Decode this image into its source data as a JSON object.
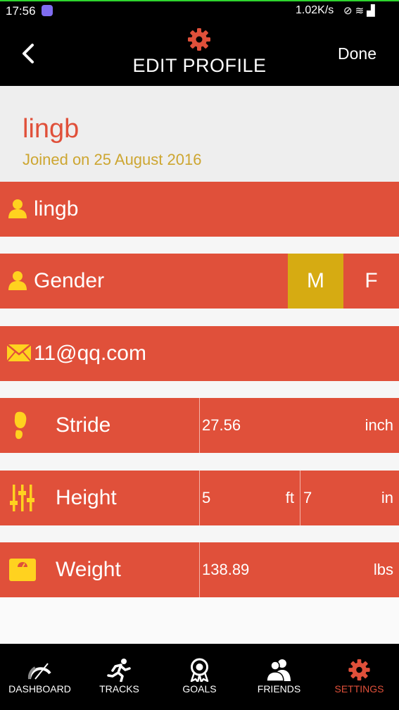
{
  "status_bar": {
    "time": "17:56",
    "network_speed": "1.02K/s"
  },
  "header": {
    "title": "EDIT PROFILE",
    "done_label": "Done"
  },
  "profile": {
    "name": "lingb",
    "joined": "Joined on 25 August 2016"
  },
  "fields": {
    "username": {
      "value": "lingb",
      "icon": "person-icon"
    },
    "gender": {
      "label": "Gender",
      "options": [
        "M",
        "F"
      ],
      "selected": "M",
      "icon": "person-icon"
    },
    "email": {
      "value": "11@qq.com",
      "icon": "envelope-icon"
    },
    "stride": {
      "label": "Stride",
      "value": "27.56",
      "unit": "inch",
      "icon": "footprint-icon"
    },
    "height": {
      "label": "Height",
      "feet": "5",
      "feet_unit": "ft",
      "inches": "7",
      "inches_unit": "in",
      "icon": "sliders-icon"
    },
    "weight": {
      "label": "Weight",
      "value": "138.89",
      "unit": "lbs",
      "icon": "scale-icon"
    }
  },
  "tabs": [
    {
      "label": "DASHBOARD",
      "icon": "speedometer-icon",
      "active": false
    },
    {
      "label": "TRACKS",
      "icon": "runner-icon",
      "active": false
    },
    {
      "label": "GOALS",
      "icon": "award-icon",
      "active": false
    },
    {
      "label": "FRIENDS",
      "icon": "friends-icon",
      "active": false
    },
    {
      "label": "SETTINGS",
      "icon": "gear-icon",
      "active": true
    }
  ],
  "colors": {
    "accent": "#e0503a",
    "selected_toggle": "#d6ab12",
    "icon_yellow": "#ffd21f",
    "joined_text": "#cda631"
  }
}
